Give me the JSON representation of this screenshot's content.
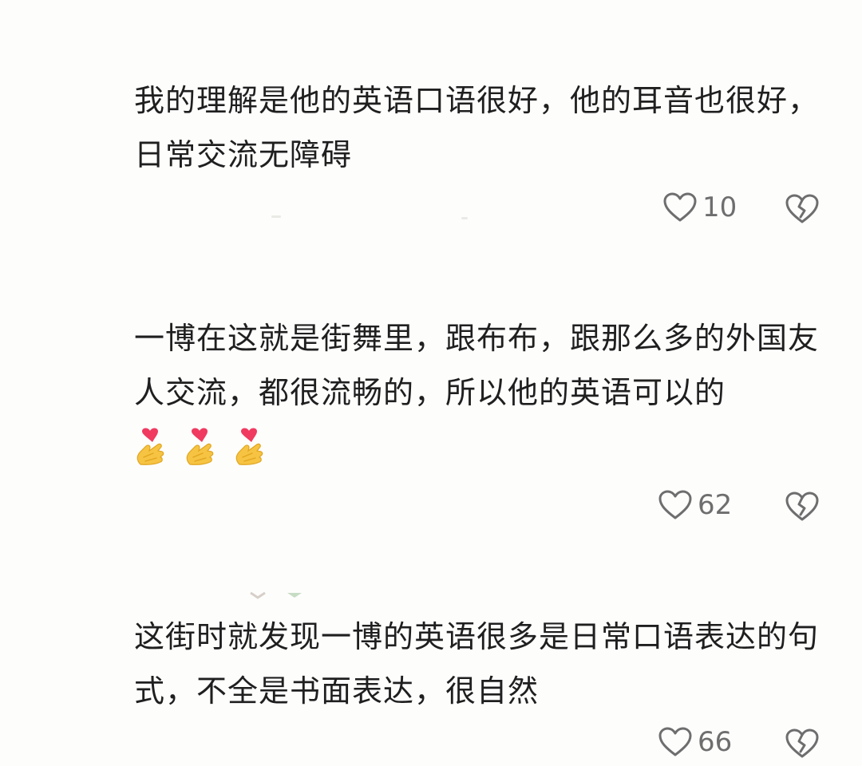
{
  "comments": [
    {
      "text": "我的理解是他的英语口语很好，他的耳音也很好，日常交流无障碍",
      "likes": "10",
      "like_icon": "heart-outline-icon",
      "dislike_icon": "broken-heart-icon",
      "emojis": []
    },
    {
      "text": "一博在这就是街舞里，跟布布，跟那么多的外国友人交流，都很流畅的，所以他的英语可以的",
      "likes": "62",
      "like_icon": "heart-outline-icon",
      "dislike_icon": "broken-heart-icon",
      "emojis": [
        "finger-heart-emoji",
        "finger-heart-emoji",
        "finger-heart-emoji"
      ]
    },
    {
      "text": "这街时就发现一博的英语很多是日常口语表达的句式，不全是书面表达，很自然",
      "likes": "66",
      "like_icon": "heart-outline-icon",
      "dislike_icon": "broken-heart-icon",
      "emojis": []
    }
  ],
  "colors": {
    "background": "#fdfdfc",
    "text": "#1f1f1f",
    "icon": "#6e6e6e",
    "emoji_heart": "#f03a5f",
    "emoji_hand": "#f6c442"
  }
}
